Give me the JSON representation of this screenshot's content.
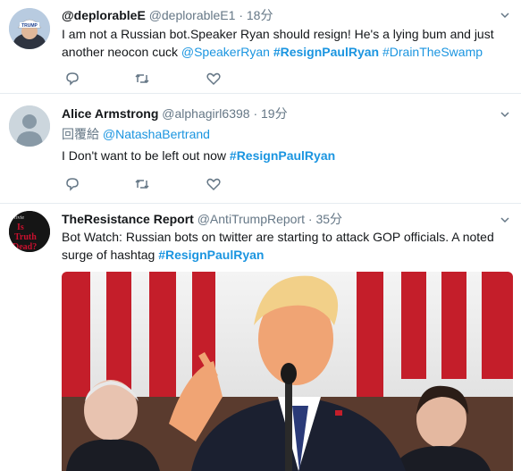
{
  "tweets": [
    {
      "name": "@deplorableE",
      "handle": "@deplorableE1",
      "separator": "·",
      "time": "18分",
      "text_plain": "I am not a Russian bot.Speaker Ryan should resign! He's a lying bum and just another neocon cuck ",
      "mention": "@SpeakerRyan",
      "hashtag1": "#ResignPaulRyan",
      "hashtag2": "#DrainTheSwamp",
      "avatar_text": "TRUMP"
    },
    {
      "name": "Alice Armstrong",
      "handle": "@alphagirl6398",
      "separator": "·",
      "time": "19分",
      "reply_prefix": "回覆給",
      "reply_to": "@NatashaBertrand",
      "text_plain": "I Don't want to be left out now ",
      "hashtag1": "#ResignPaulRyan"
    },
    {
      "name": "TheResistance Report",
      "handle": "@AntiTrumpReport",
      "separator": "·",
      "time": "35分",
      "text_plain": "Bot Watch: Russian bots on twitter are starting to attack GOP officials. A noted surge of hashtag ",
      "hashtag1": "#ResignPaulRyan",
      "avatar_lines": [
        "Is",
        "Truth",
        "Dead?"
      ]
    }
  ],
  "colors": {
    "link": "#1b95e0",
    "muted": "#657786",
    "text": "#14171a",
    "divider": "#e6ecf0",
    "avatar_resistance": "#1a1a1a",
    "avatar_resistance_text": "#c8102e"
  },
  "icons": [
    "reply-icon",
    "retweet-icon",
    "like-icon",
    "caret-down-icon",
    "default-avatar-icon"
  ]
}
